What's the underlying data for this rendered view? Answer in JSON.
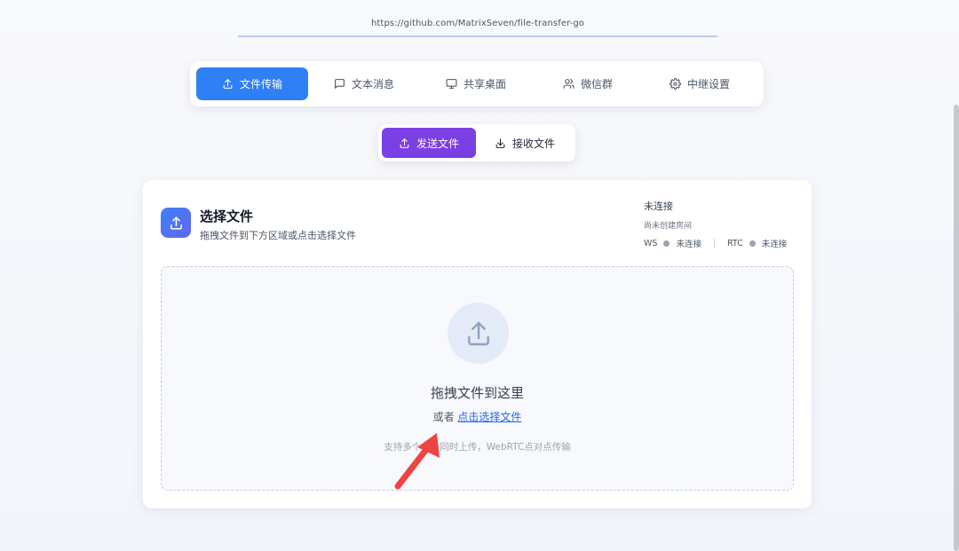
{
  "url": "https://github.com/MatrixSeven/file-transfer-go",
  "main_nav": [
    {
      "label": "文件传输",
      "icon": "upload-icon",
      "active": true
    },
    {
      "label": "文本消息",
      "icon": "message-icon",
      "active": false
    },
    {
      "label": "共享桌面",
      "icon": "monitor-icon",
      "active": false
    },
    {
      "label": "微信群",
      "icon": "users-icon",
      "active": false
    },
    {
      "label": "中继设置",
      "icon": "gear-icon",
      "active": false
    }
  ],
  "sub_nav": [
    {
      "label": "发送文件",
      "icon": "upload-icon",
      "active": true
    },
    {
      "label": "接收文件",
      "icon": "download-icon",
      "active": false
    }
  ],
  "card": {
    "icon": "upload-icon",
    "title": "选择文件",
    "subtitle": "拖拽文件到下方区域或点击选择文件"
  },
  "status": {
    "connection": "未连接",
    "room": "尚未创建房间",
    "ws_label": "WS",
    "ws_status": "未连接",
    "rtc_label": "RTC",
    "rtc_status": "未连接"
  },
  "dropzone": {
    "icon": "upload-icon",
    "title": "拖拽文件到这里",
    "or_text": "或者",
    "link_text": "点击选择文件",
    "hint": "支持多个文件同时上传，WebRTC点对点传输"
  },
  "colors": {
    "primary_blue": "#2f80f5",
    "purple": "#7b3fe4",
    "link_blue": "#2563eb",
    "annotation_red": "#ef4444"
  }
}
